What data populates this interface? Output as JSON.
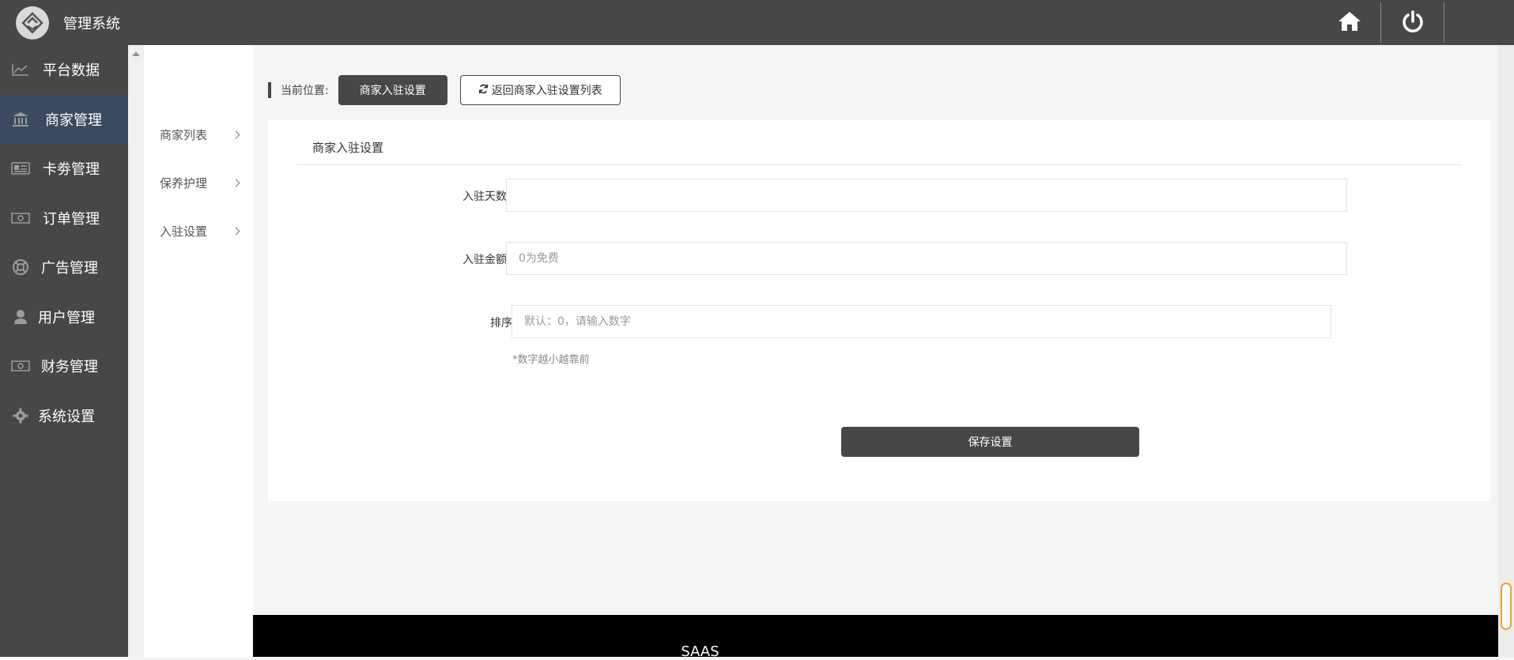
{
  "header": {
    "app_title": "管理系统",
    "logo_icon": "logo-icon",
    "home_icon": "home-icon",
    "power_icon": "power-icon"
  },
  "sidebar": {
    "items": [
      {
        "label": "平台数据",
        "icon": "chart-line-icon"
      },
      {
        "label": "商家管理",
        "icon": "bank-icon",
        "active": true
      },
      {
        "label": "卡劵管理",
        "icon": "card-icon"
      },
      {
        "label": "订单管理",
        "icon": "money-icon"
      },
      {
        "label": "广告管理",
        "icon": "lifebuoy-icon"
      },
      {
        "label": "用户管理",
        "icon": "user-icon"
      },
      {
        "label": "财务管理",
        "icon": "money-icon"
      },
      {
        "label": "系统设置",
        "icon": "gear-icon"
      }
    ]
  },
  "subnav": {
    "items": [
      {
        "label": "商家列表"
      },
      {
        "label": "保养护理"
      },
      {
        "label": "入驻设置"
      }
    ]
  },
  "breadcrumb": {
    "label": "当前位置:",
    "current": "商家入驻设置",
    "back_button": "返回商家入驻设置列表"
  },
  "panel": {
    "title": "商家入驻设置",
    "fields": [
      {
        "label": "入驻天数",
        "value": "",
        "placeholder": ""
      },
      {
        "label": "入驻金额",
        "value": "",
        "placeholder": "0为免费"
      },
      {
        "label": "排序",
        "value": "",
        "placeholder": "默认：0，请输入数字"
      }
    ],
    "hint": "*数字越小越靠前",
    "save_label": "保存设置"
  },
  "footer": {
    "text": "SAAS"
  }
}
